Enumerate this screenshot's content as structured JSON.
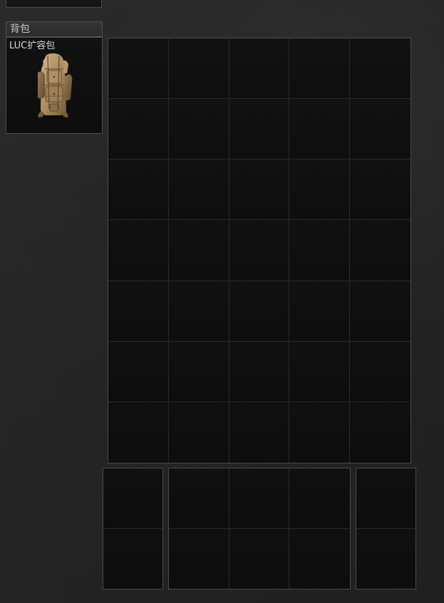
{
  "sidebar": {
    "section_title": "背包",
    "equipped_backpack": {
      "name": "LUC扩容包",
      "icon": "backpack-icon"
    }
  },
  "containers": {
    "main_grid": {
      "columns": 5,
      "rows": 7
    },
    "left_pocket": {
      "columns": 1,
      "rows": 2
    },
    "middle_pocket": {
      "columns": 3,
      "rows": 2
    },
    "right_pocket": {
      "columns": 1,
      "rows": 2
    }
  },
  "colors": {
    "background": "#252525",
    "panel_border": "#4a4a4a",
    "grid_fill": "#0d0d0d",
    "grid_line": "#2a2a2a",
    "text": "#d8d8d8",
    "backpack_tan": "#a88a5d"
  }
}
